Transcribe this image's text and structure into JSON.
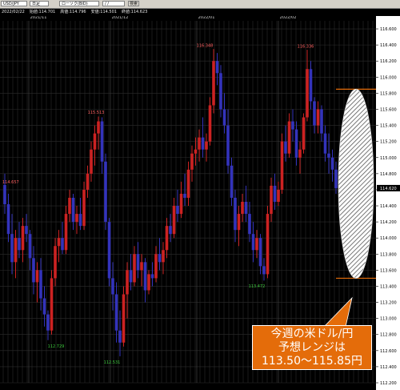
{
  "toolbar": {
    "symbol": "USD/JPY",
    "timeframe": "日足",
    "chart_style": "ローソク(BID)",
    "date_field": "/ /",
    "search_button": "検索"
  },
  "info": {
    "date": "2022/02/22",
    "open": "始値:114.701",
    "high": "高値:114.796",
    "low": "安値:114.501",
    "close": "終値:114.623"
  },
  "colors": {
    "up": "#cc2222",
    "down": "#3333bb",
    "grid": "#2c2c2c",
    "callout_bg": "#e46c0a",
    "range_line": "#e46c0a",
    "axis_bg": "#ffffff",
    "high_label": "#ff6060",
    "low_label": "#3cc93c"
  },
  "chart_data": {
    "type": "candlestick",
    "title": "",
    "ylim": [
      112.2,
      116.7
    ],
    "y_ticks": [
      "116.600",
      "116.400",
      "116.200",
      "116.000",
      "115.800",
      "115.600",
      "115.400",
      "115.200",
      "115.000",
      "114.800",
      "114.600",
      "114.400",
      "114.200",
      "114.000",
      "113.800",
      "113.600",
      "113.400",
      "113.200",
      "113.000",
      "112.800",
      "112.600",
      "112.400",
      "112.200"
    ],
    "x_labels": [
      "2021/11",
      "2021/12",
      "2022/01",
      "2022/02"
    ],
    "last_price_label": "114.620",
    "annotations": {
      "left_edge": "114.657",
      "high_nov": "115.513",
      "low_nov": "112.729",
      "low_dec": "112.531",
      "high_jan": "116.348",
      "low_jan": "113.472",
      "high_feb": "116.336"
    },
    "forecast_range": [
      113.5,
      115.85
    ],
    "ohlc": [
      [
        114.66,
        114.8,
        114.3,
        114.42
      ],
      [
        114.42,
        114.55,
        113.95,
        114.05
      ],
      [
        114.05,
        114.3,
        113.55,
        113.7
      ],
      [
        113.7,
        114.1,
        113.5,
        114.0
      ],
      [
        114.0,
        114.2,
        113.75,
        113.85
      ],
      [
        113.85,
        114.25,
        113.7,
        114.15
      ],
      [
        114.15,
        114.3,
        113.95,
        114.05
      ],
      [
        114.05,
        114.1,
        113.6,
        113.75
      ],
      [
        113.75,
        113.9,
        113.3,
        113.45
      ],
      [
        113.45,
        113.7,
        113.2,
        113.6
      ],
      [
        113.6,
        113.75,
        113.1,
        113.25
      ],
      [
        113.25,
        113.4,
        112.9,
        113.05
      ],
      [
        113.05,
        113.1,
        112.73,
        112.85
      ],
      [
        112.85,
        113.6,
        112.8,
        113.5
      ],
      [
        113.5,
        114.0,
        113.4,
        113.9
      ],
      [
        113.9,
        114.1,
        113.7,
        114.0
      ],
      [
        114.0,
        114.2,
        113.8,
        113.85
      ],
      [
        113.85,
        114.4,
        113.8,
        114.3
      ],
      [
        114.3,
        114.6,
        114.2,
        114.5
      ],
      [
        114.5,
        114.55,
        114.1,
        114.2
      ],
      [
        114.2,
        114.4,
        114.05,
        114.3
      ],
      [
        114.3,
        114.5,
        114.1,
        114.15
      ],
      [
        114.15,
        114.7,
        114.1,
        114.6
      ],
      [
        114.6,
        114.9,
        114.5,
        114.8
      ],
      [
        114.8,
        115.2,
        114.7,
        115.1
      ],
      [
        115.1,
        115.4,
        114.9,
        115.3
      ],
      [
        115.3,
        115.51,
        115.1,
        115.45
      ],
      [
        115.45,
        115.5,
        114.8,
        114.95
      ],
      [
        114.95,
        115.05,
        114.1,
        114.2
      ],
      [
        114.2,
        114.25,
        113.4,
        113.5
      ],
      [
        113.5,
        113.7,
        113.1,
        113.3
      ],
      [
        113.3,
        113.45,
        112.7,
        112.85
      ],
      [
        112.85,
        113.1,
        112.53,
        112.7
      ],
      [
        112.7,
        113.4,
        112.65,
        113.3
      ],
      [
        113.3,
        113.7,
        113.0,
        113.6
      ],
      [
        113.6,
        113.8,
        113.35,
        113.45
      ],
      [
        113.45,
        113.9,
        113.4,
        113.8
      ],
      [
        113.8,
        113.95,
        113.5,
        113.6
      ],
      [
        113.6,
        113.8,
        113.4,
        113.7
      ],
      [
        113.7,
        113.75,
        113.2,
        113.35
      ],
      [
        113.35,
        113.6,
        113.3,
        113.55
      ],
      [
        113.55,
        113.7,
        113.4,
        113.5
      ],
      [
        113.5,
        113.9,
        113.45,
        113.8
      ],
      [
        113.8,
        114.0,
        113.6,
        113.7
      ],
      [
        113.7,
        113.95,
        113.55,
        113.85
      ],
      [
        113.85,
        114.25,
        113.75,
        114.15
      ],
      [
        114.15,
        114.3,
        113.95,
        114.05
      ],
      [
        114.05,
        114.5,
        114.0,
        114.4
      ],
      [
        114.4,
        114.6,
        114.2,
        114.3
      ],
      [
        114.3,
        114.7,
        114.25,
        114.55
      ],
      [
        114.55,
        114.8,
        114.4,
        114.5
      ],
      [
        114.5,
        114.95,
        114.4,
        114.85
      ],
      [
        114.85,
        115.15,
        114.7,
        115.05
      ],
      [
        115.05,
        115.25,
        114.9,
        115.1
      ],
      [
        115.1,
        115.35,
        114.95,
        115.25
      ],
      [
        115.25,
        115.5,
        115.0,
        115.1
      ],
      [
        115.1,
        115.3,
        114.95,
        115.2
      ],
      [
        115.2,
        115.75,
        115.15,
        115.65
      ],
      [
        115.65,
        116.35,
        115.55,
        116.2
      ],
      [
        116.2,
        116.3,
        115.9,
        116.05
      ],
      [
        116.05,
        116.15,
        115.5,
        115.6
      ],
      [
        115.6,
        115.8,
        115.3,
        115.4
      ],
      [
        115.4,
        115.6,
        114.8,
        114.9
      ],
      [
        114.9,
        115.0,
        114.4,
        114.5
      ],
      [
        114.5,
        114.6,
        113.95,
        114.1
      ],
      [
        114.1,
        114.4,
        113.9,
        114.3
      ],
      [
        114.3,
        114.55,
        114.2,
        114.45
      ],
      [
        114.45,
        114.65,
        114.2,
        114.3
      ],
      [
        114.3,
        114.45,
        113.95,
        114.05
      ],
      [
        114.05,
        114.2,
        113.7,
        113.85
      ],
      [
        113.85,
        114.1,
        113.75,
        114.0
      ],
      [
        114.0,
        114.05,
        113.55,
        113.65
      ],
      [
        113.65,
        113.75,
        113.47,
        113.55
      ],
      [
        113.55,
        114.4,
        113.5,
        114.3
      ],
      [
        114.3,
        114.75,
        114.2,
        114.65
      ],
      [
        114.65,
        114.8,
        114.35,
        114.45
      ],
      [
        114.45,
        114.7,
        114.4,
        114.6
      ],
      [
        114.6,
        115.3,
        114.55,
        115.2
      ],
      [
        115.2,
        115.4,
        114.95,
        115.05
      ],
      [
        115.05,
        115.55,
        115.0,
        115.45
      ],
      [
        115.45,
        115.6,
        115.2,
        115.35
      ],
      [
        115.35,
        115.45,
        114.9,
        115.0
      ],
      [
        115.0,
        115.2,
        114.8,
        115.1
      ],
      [
        115.1,
        115.55,
        115.05,
        115.5
      ],
      [
        115.5,
        116.34,
        115.45,
        116.1
      ],
      [
        116.1,
        116.2,
        115.6,
        115.7
      ],
      [
        115.7,
        115.75,
        115.3,
        115.4
      ],
      [
        115.4,
        115.7,
        115.3,
        115.6
      ],
      [
        115.6,
        115.65,
        115.2,
        115.3
      ],
      [
        115.3,
        115.4,
        114.95,
        115.05
      ],
      [
        115.05,
        115.3,
        114.8,
        115.0
      ],
      [
        115.0,
        115.1,
        114.7,
        114.85
      ],
      [
        114.85,
        114.95,
        114.55,
        114.62
      ]
    ]
  }
}
